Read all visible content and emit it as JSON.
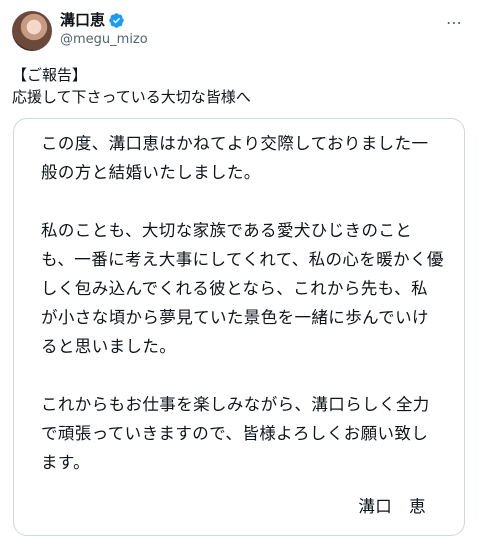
{
  "header": {
    "display_name": "溝口恵",
    "handle": "@megu_mizo",
    "verified": true,
    "more_icon": "⋯"
  },
  "tweet": {
    "text_line1": "【ご報告】",
    "text_line2": "応援して下さっている大切な皆様へ"
  },
  "letter": {
    "paragraph1": "この度、溝口恵はかねてより交際しておりました一般の方と結婚いたしました。",
    "paragraph2": "私のことも、大切な家族である愛犬ひじきのことも、一番に考え大事にしてくれて、私の心を暖かく優しく包み込んでくれる彼となら、これから先も、私が小さな頃から夢見ていた景色を一緒に歩んでいけると思いました。",
    "paragraph3": "これからもお仕事を楽しみながら、溝口らしく全力で頑張っていきますので、皆様よろしくお願い致します。",
    "signature": "溝口　恵"
  },
  "colors": {
    "verified": "#1d9bf0",
    "secondary_text": "#536471",
    "border": "#cfd9de"
  }
}
